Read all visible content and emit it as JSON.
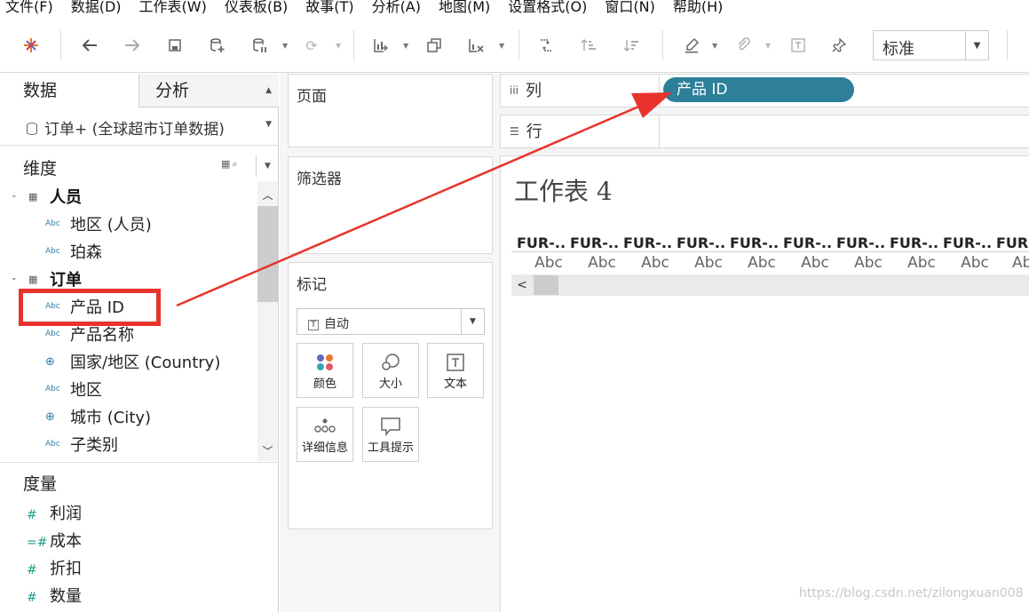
{
  "menubar": {
    "items": [
      "文件(F)",
      "数据(D)",
      "工作表(W)",
      "仪表板(B)",
      "故事(T)",
      "分析(A)",
      "地图(M)",
      "设置格式(O)",
      "窗口(N)",
      "帮助(H)"
    ]
  },
  "toolbar": {
    "fit_value": "标准",
    "icons": [
      "tableau-logo-icon",
      "undo-icon",
      "redo-icon",
      "save-icon",
      "new-datasource-icon",
      "pause-updates-icon",
      "refresh-icon",
      "new-worksheet-icon",
      "duplicate-sheet-icon",
      "clear-sheet-icon",
      "swap-icon",
      "sort-asc-icon",
      "sort-desc-icon",
      "highlight-icon",
      "group-icon",
      "label-icon",
      "pin-icon"
    ]
  },
  "left_panel": {
    "tab_data": "数据",
    "tab_analysis": "分析",
    "datasource": "订单+ (全球超市订单数据)",
    "dimensions_header": "维度",
    "dimension_rows": [
      {
        "type": "folder",
        "label": "人员"
      },
      {
        "type": "abc",
        "icon_text": "Abc",
        "label": "地区 (人员)"
      },
      {
        "type": "abc",
        "icon_text": "Abc",
        "label": "珀森"
      },
      {
        "type": "folder",
        "label": "订单"
      },
      {
        "type": "abc",
        "icon_text": "Abc",
        "label": "产品 ID"
      },
      {
        "type": "abc",
        "icon_text": "Abc",
        "label": "产品名称"
      },
      {
        "type": "globe",
        "label": "国家/地区 (Country)"
      },
      {
        "type": "abc",
        "icon_text": "Abc",
        "label": "地区"
      },
      {
        "type": "globe",
        "label": "城市 (City)"
      },
      {
        "type": "abc",
        "icon_text": "Abc",
        "label": "子类别"
      }
    ],
    "measures_header": "度量",
    "measure_rows": [
      {
        "label": "利润"
      },
      {
        "label": "成本"
      },
      {
        "label": "折扣"
      },
      {
        "label": "数量"
      }
    ]
  },
  "cards": {
    "pages_title": "页面",
    "filters_title": "筛选器",
    "marks_title": "标记",
    "mark_type": "自动",
    "mark_buttons": [
      "颜色",
      "大小",
      "文本",
      "详细信息",
      "工具提示"
    ]
  },
  "shelves": {
    "columns_label": "列",
    "rows_label": "行",
    "columns_pill": "产品 ID"
  },
  "view": {
    "title": "工作表 4",
    "headers": [
      "FUR-..",
      "FUR-..",
      "FUR-..",
      "FUR-..",
      "FUR-..",
      "FUR-..",
      "FUR-..",
      "FUR-..",
      "FUR-..",
      "FUR-."
    ],
    "cells": [
      "Abc",
      "Abc",
      "Abc",
      "Abc",
      "Abc",
      "Abc",
      "Abc",
      "Abc",
      "Abc",
      "Ab"
    ]
  },
  "watermark": "https://blog.csdn.net/zilongxuan008",
  "colors": {
    "pill": "#2d7f9a",
    "annotation": "#e8322c",
    "measure_icon": "#1b9e8a",
    "dimension_icon": "#2f7ea8"
  }
}
